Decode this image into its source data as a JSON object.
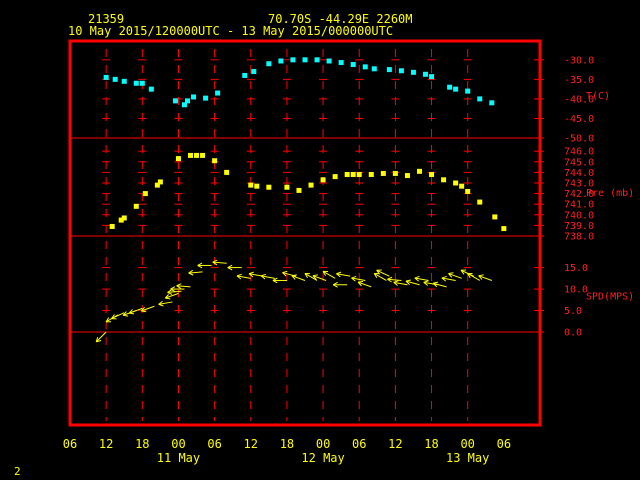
{
  "header": {
    "station_id": "21359",
    "location": "70.70S   -44.29E   2260M",
    "time_range": "10 May 2015/120000UTC - 13 May 2015/000000UTC"
  },
  "page_number": "2",
  "colors": {
    "frame": "#ff0000",
    "text": "#ffff00",
    "temperature": "#00ffff",
    "pressure": "#ffff00",
    "wind": "#ffff00",
    "background": "#000000"
  },
  "chart_data": {
    "type": "scatter",
    "x_axis": {
      "tick_labels": [
        "06",
        "12",
        "18",
        "00",
        "06",
        "12",
        "18",
        "00",
        "06",
        "12",
        "18",
        "00",
        "06"
      ],
      "date_labels": [
        {
          "label": "11 May",
          "tick_index": 3
        },
        {
          "label": "12 May",
          "tick_index": 7
        },
        {
          "label": "13 May",
          "tick_index": 11
        }
      ]
    },
    "panels": [
      {
        "name": "temperature",
        "label": "T(C)",
        "tick_labels": [
          "-30.0",
          "-35.0",
          "-40.0",
          "-45.0",
          "-50.0"
        ],
        "ylim": [
          -50,
          -28
        ],
        "series": [
          {
            "marker": "square",
            "points": [
              [
                12.0,
                -34.5
              ],
              [
                13.5,
                -35.0
              ],
              [
                15.0,
                -35.5
              ],
              [
                17.0,
                -36.0
              ],
              [
                18.0,
                -36.0
              ],
              [
                19.5,
                -37.5
              ],
              [
                23.5,
                -40.5
              ],
              [
                25.0,
                -41.5
              ],
              [
                25.5,
                -40.5
              ],
              [
                26.5,
                -39.5
              ],
              [
                28.5,
                -39.8
              ],
              [
                30.5,
                -38.5
              ],
              [
                35.0,
                -34.0
              ],
              [
                36.5,
                -33.0
              ],
              [
                39.0,
                -31.0
              ],
              [
                41.0,
                -30.3
              ],
              [
                43.0,
                -30.0
              ],
              [
                45.0,
                -30.0
              ],
              [
                47.0,
                -30.0
              ],
              [
                49.0,
                -30.3
              ],
              [
                51.0,
                -30.7
              ],
              [
                53.0,
                -31.2
              ],
              [
                55.0,
                -31.8
              ],
              [
                56.5,
                -32.3
              ],
              [
                59.0,
                -32.5
              ],
              [
                61.0,
                -32.8
              ],
              [
                63.0,
                -33.2
              ],
              [
                65.0,
                -33.7
              ],
              [
                66.0,
                -34.3
              ],
              [
                69.0,
                -37.0
              ],
              [
                70.0,
                -37.5
              ],
              [
                72.0,
                -38.0
              ],
              [
                74.0,
                -40.0
              ],
              [
                76.0,
                -41.0
              ]
            ]
          }
        ]
      },
      {
        "name": "pressure",
        "label": "Pre (mb)",
        "tick_labels": [
          "746.0",
          "745.0",
          "744.0",
          "743.0",
          "742.0",
          "741.0",
          "740.0",
          "739.0",
          "738.0"
        ],
        "ylim": [
          738,
          746.3
        ],
        "series": [
          {
            "marker": "square",
            "points": [
              [
                13.0,
                738.9
              ],
              [
                14.5,
                739.5
              ],
              [
                15.0,
                739.7
              ],
              [
                17.0,
                740.8
              ],
              [
                18.5,
                742.0
              ],
              [
                20.5,
                742.8
              ],
              [
                21.0,
                743.1
              ],
              [
                24.0,
                745.3
              ],
              [
                26.0,
                745.6
              ],
              [
                27.0,
                745.6
              ],
              [
                28.0,
                745.6
              ],
              [
                30.0,
                745.1
              ],
              [
                32.0,
                744.0
              ],
              [
                36.0,
                742.8
              ],
              [
                37.0,
                742.7
              ],
              [
                39.0,
                742.6
              ],
              [
                42.0,
                742.6
              ],
              [
                44.0,
                742.3
              ],
              [
                46.0,
                742.8
              ],
              [
                48.0,
                743.3
              ],
              [
                50.0,
                743.6
              ],
              [
                52.0,
                743.8
              ],
              [
                53.0,
                743.8
              ],
              [
                54.0,
                743.8
              ],
              [
                56.0,
                743.8
              ],
              [
                58.0,
                743.9
              ],
              [
                60.0,
                743.9
              ],
              [
                62.0,
                743.7
              ],
              [
                64.0,
                744.1
              ],
              [
                66.0,
                743.8
              ],
              [
                68.0,
                743.3
              ],
              [
                70.0,
                743.0
              ],
              [
                71.0,
                742.7
              ],
              [
                72.0,
                742.2
              ],
              [
                74.0,
                741.2
              ],
              [
                76.5,
                739.8
              ],
              [
                78.0,
                738.7
              ]
            ]
          }
        ]
      },
      {
        "name": "wind",
        "label": "SPD(MPS)",
        "tick_labels": [
          "15.0",
          "10.0",
          "5.0",
          "0.0"
        ],
        "ylim": [
          0,
          17
        ],
        "series": [
          {
            "marker": "arrow",
            "points": [
              [
                12.0,
                0.0,
                225
              ],
              [
                14.0,
                4.0,
                240
              ],
              [
                15.0,
                4.5,
                245
              ],
              [
                17.0,
                5.0,
                250
              ],
              [
                18.0,
                5.5,
                250
              ],
              [
                20.0,
                6.0,
                250
              ],
              [
                23.0,
                7.0,
                260
              ],
              [
                24.0,
                9.0,
                250
              ],
              [
                24.5,
                9.5,
                265
              ],
              [
                25.0,
                10.0,
                270
              ],
              [
                26.0,
                10.5,
                275
              ],
              [
                28.0,
                14.0,
                265
              ],
              [
                29.5,
                15.5,
                270
              ],
              [
                32.0,
                16.0,
                275
              ],
              [
                34.5,
                15.0,
                270
              ],
              [
                36.0,
                12.5,
                280
              ],
              [
                38.0,
                13.0,
                280
              ],
              [
                40.0,
                12.5,
                280
              ],
              [
                42.0,
                12.0,
                270
              ],
              [
                43.5,
                13.0,
                285
              ],
              [
                45.0,
                12.0,
                290
              ],
              [
                47.0,
                12.0,
                300
              ],
              [
                48.5,
                12.0,
                290
              ],
              [
                50.0,
                12.5,
                300
              ],
              [
                52.0,
                11.0,
                270
              ],
              [
                52.5,
                13.0,
                280
              ],
              [
                55.0,
                12.0,
                280
              ],
              [
                56.0,
                10.5,
                290
              ],
              [
                58.5,
                12.0,
                300
              ],
              [
                59.0,
                13.0,
                295
              ],
              [
                61.0,
                12.0,
                275
              ],
              [
                62.0,
                11.0,
                280
              ],
              [
                64.0,
                11.0,
                285
              ],
              [
                65.5,
                12.0,
                280
              ],
              [
                67.0,
                11.0,
                280
              ],
              [
                68.5,
                10.5,
                285
              ],
              [
                70.0,
                12.0,
                280
              ],
              [
                71.0,
                12.5,
                290
              ],
              [
                73.0,
                13.0,
                295
              ],
              [
                74.0,
                12.0,
                300
              ],
              [
                76.0,
                12.0,
                290
              ]
            ]
          }
        ]
      }
    ]
  }
}
